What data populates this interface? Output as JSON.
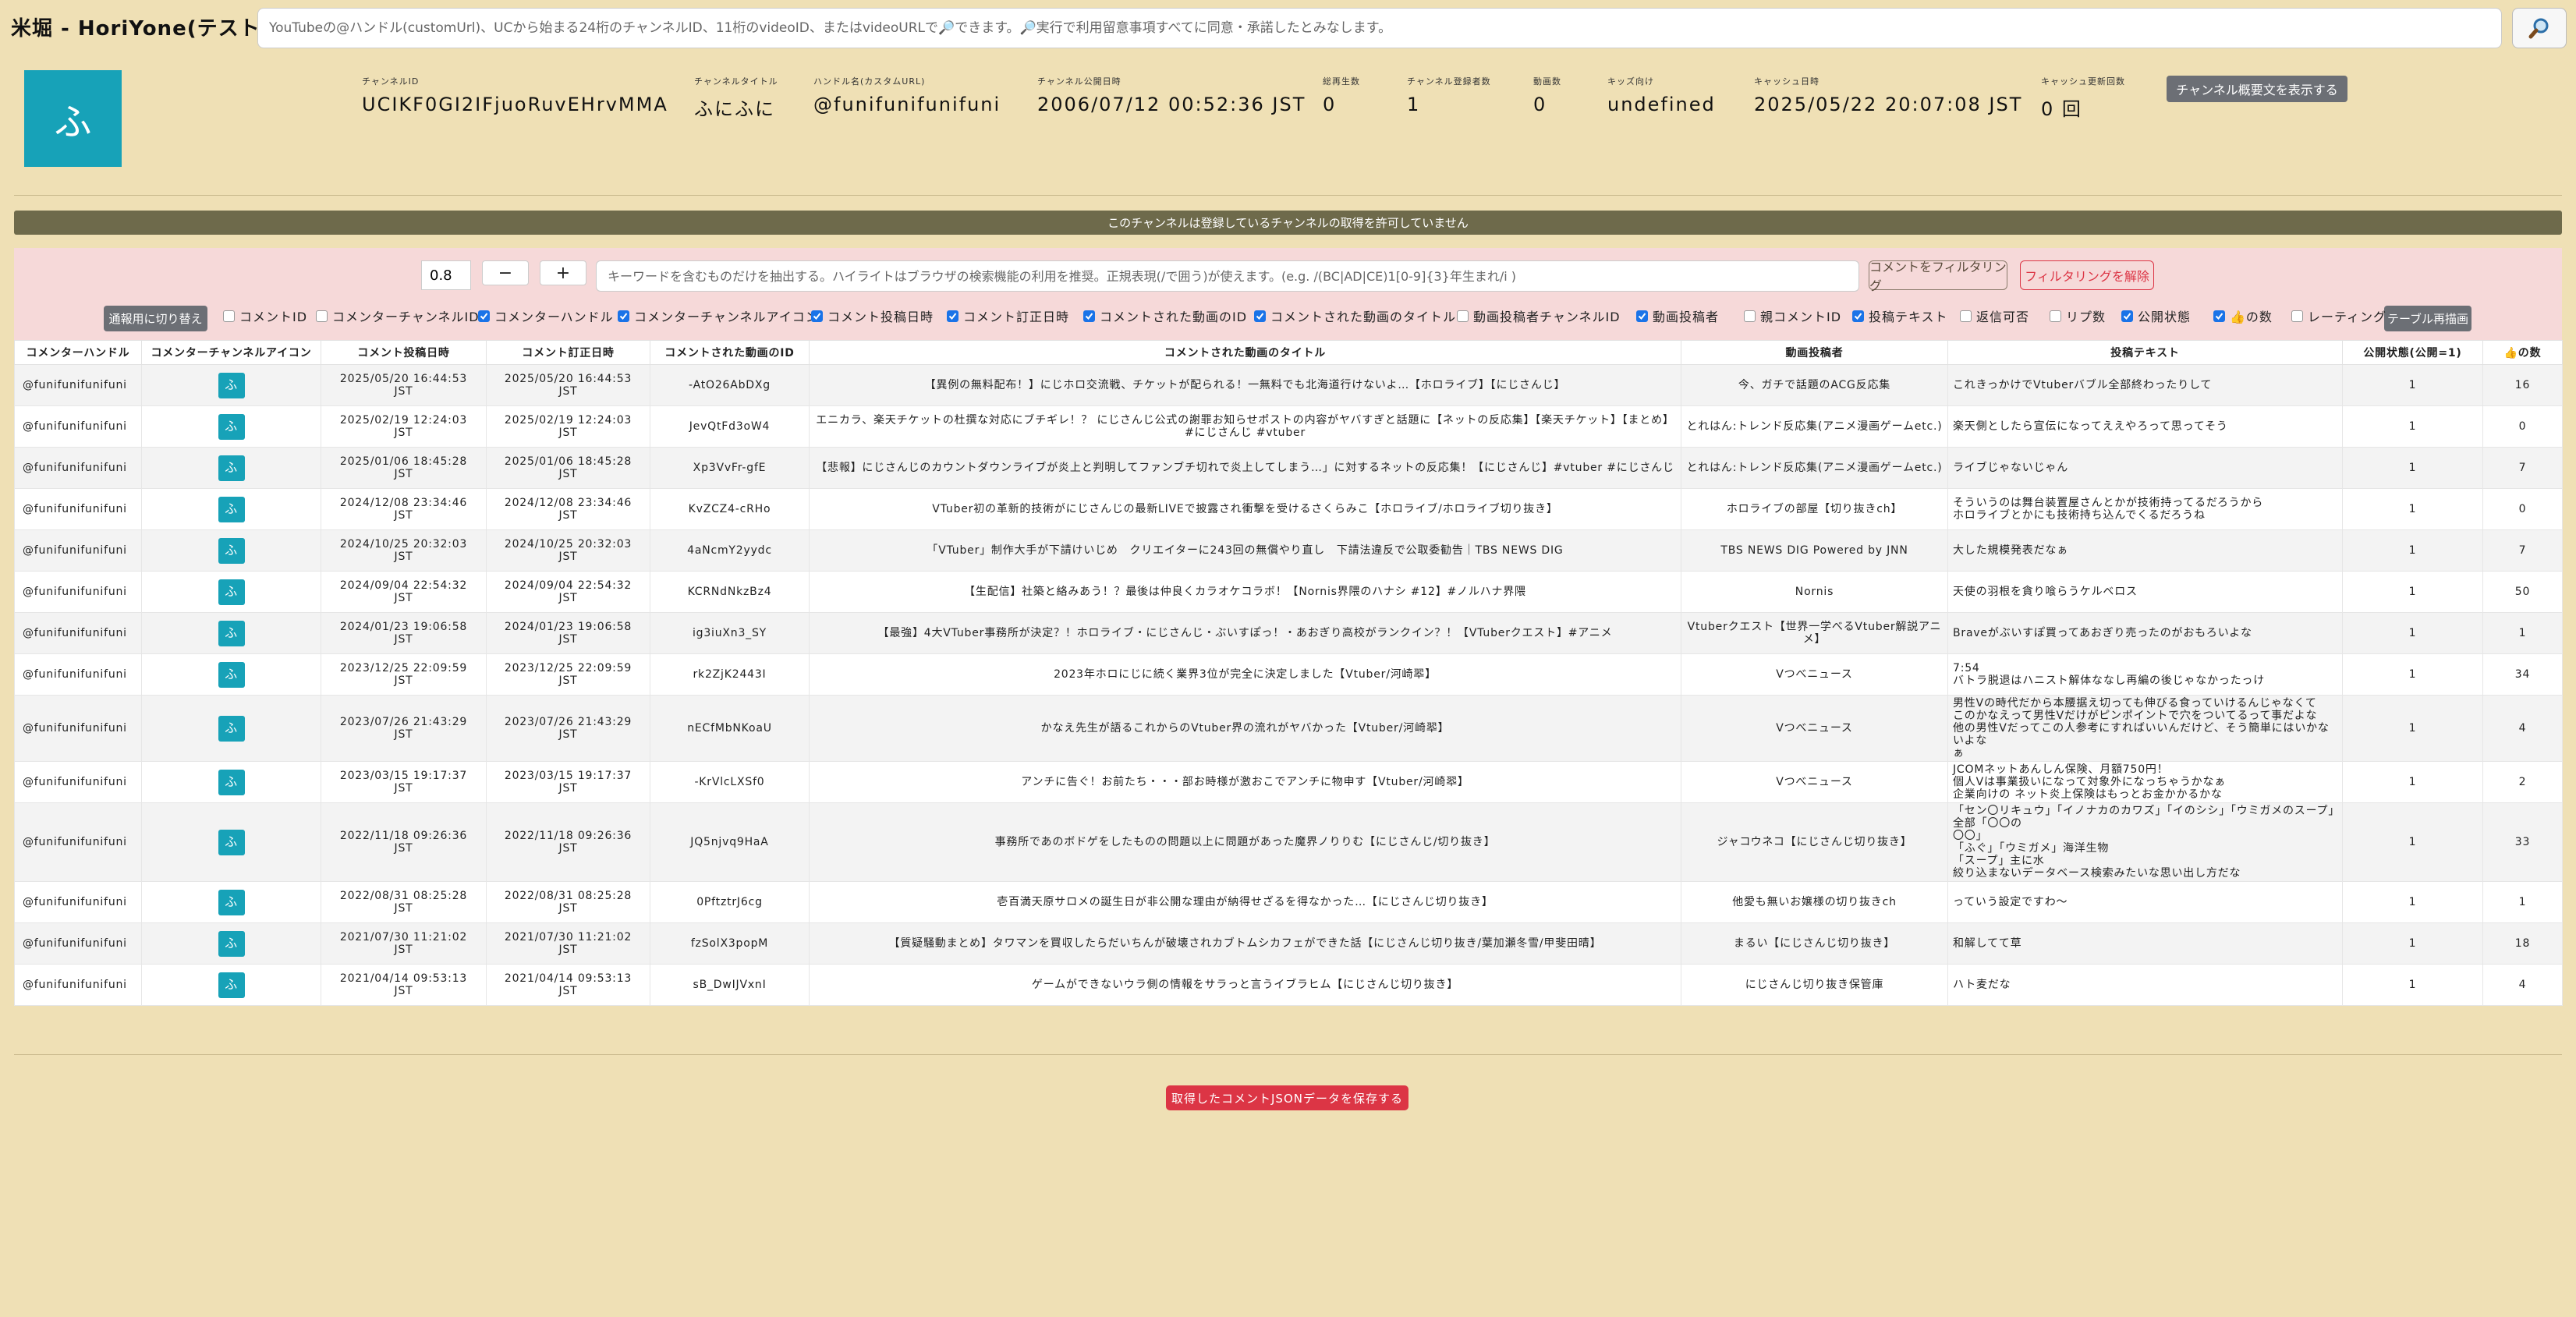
{
  "header": {
    "app_title": "米堀 - HoriYone(テスト中)",
    "search_placeholder": "YouTubeの@ハンドル(customUrl)、UCから始まる24桁のチャンネルID、11桁のvideoID、またはvideoURLで🔎できます。🔎実行で利用留意事項すべてに同意・承諾したとみなします。",
    "search_icon": "magnifier-icon"
  },
  "channel": {
    "avatar_char": "ふ",
    "fields": [
      {
        "label": "チャンネルID",
        "value": "UCIKF0GI2IFjuoRuvEHrvMMA"
      },
      {
        "label": "チャンネルタイトル",
        "value": "ふにふに"
      },
      {
        "label": "ハンドル名(カスタムURL)",
        "value": "@funifunifunifuni"
      },
      {
        "label": "チャンネル公開日時",
        "value": "2006/07/12 00:52:36 JST"
      },
      {
        "label": "総再生数",
        "value": "0"
      },
      {
        "label": "チャンネル登録者数",
        "value": "1"
      },
      {
        "label": "動画数",
        "value": "0"
      },
      {
        "label": "キッズ向け",
        "value": "undefined"
      },
      {
        "label": "キャッシュ日時",
        "value": "2025/05/22 20:07:08 JST"
      },
      {
        "label": "キャッシュ更新回数",
        "value": "0 回"
      }
    ],
    "desc_button": "チャンネル概要文を表示する"
  },
  "banner": "このチャンネルは登録しているチャンネルの取得を許可していません",
  "filter": {
    "zoom_value": "0.8",
    "minus_label": "−",
    "plus_label": "+",
    "keyword_placeholder": "キーワードを含むものだけを抽出する。ハイライトはブラウザの検索機能の利用を推奨。正規表現(/で囲う)が使えます。(e.g. /(BC|AD|CE)1[0-9]{3}年生まれ/i )",
    "filter_button": "コメントをフィルタリング",
    "clear_button": "フィルタリングを解除",
    "switch_button": "通報用に切り替え",
    "redraw_button": "テーブル再描画",
    "columns": [
      {
        "label": "コメントID",
        "checked": false
      },
      {
        "label": "コメンターチャンネルID",
        "checked": false
      },
      {
        "label": "コメンターハンドル",
        "checked": true
      },
      {
        "label": "コメンターチャンネルアイコン",
        "checked": true
      },
      {
        "label": "コメント投稿日時",
        "checked": true
      },
      {
        "label": "コメント訂正日時",
        "checked": true
      },
      {
        "label": "コメントされた動画のID",
        "checked": true
      },
      {
        "label": "コメントされた動画のタイトル",
        "checked": true
      },
      {
        "label": "動画投稿者チャンネルID",
        "checked": false
      },
      {
        "label": "動画投稿者",
        "checked": true
      },
      {
        "label": "親コメントID",
        "checked": false
      },
      {
        "label": "投稿テキスト",
        "checked": true
      },
      {
        "label": "返信可否",
        "checked": false
      },
      {
        "label": "リプ数",
        "checked": false
      },
      {
        "label": "公開状態",
        "checked": true
      },
      {
        "label": "👍の数",
        "checked": true
      },
      {
        "label": "レーティング",
        "checked": false
      }
    ]
  },
  "table": {
    "headers": [
      "コメンターハンドル",
      "コメンターチャンネルアイコン",
      "コメント投稿日時",
      "コメント訂正日時",
      "コメントされた動画のID",
      "コメントされた動画のタイトル",
      "動画投稿者",
      "投稿テキスト",
      "公開状態(公開=1)",
      "👍の数"
    ],
    "rows": [
      {
        "handle": "@funifunifunifuni",
        "icon": "ふ",
        "posted": "2025/05/20 16:44:53\nJST",
        "edited": "2025/05/20 16:44:53\nJST",
        "video_id": "-AtO26AbDXg",
        "title": "【異例の無料配布！】にじホロ交流戦、チケットが配られる！一無料でも北海道行けないよ…【ホロライブ】【にじさんじ】",
        "uploader": "今、ガチで話題のACG反応集",
        "text": "これきっかけでVtuberバブル全部終わったりして",
        "status": "1",
        "likes": "16"
      },
      {
        "handle": "@funifunifunifuni",
        "icon": "ふ",
        "posted": "2025/02/19 12:24:03\nJST",
        "edited": "2025/02/19 12:24:03\nJST",
        "video_id": "JevQtFd3oW4",
        "title": "エニカラ、楽天チケットの杜撰な対応にブチギレ！？ にじさんじ公式の謝罪お知らせポストの内容がヤバすぎと話題に【ネットの反応集】【楽天チケット】【まとめ】#にじさんじ #vtuber",
        "uploader": "とれはん:トレンド反応集(アニメ漫画ゲームetc.)",
        "text": "楽天側としたら宣伝になってええやろって思ってそう",
        "status": "1",
        "likes": "0"
      },
      {
        "handle": "@funifunifunifuni",
        "icon": "ふ",
        "posted": "2025/01/06 18:45:28\nJST",
        "edited": "2025/01/06 18:45:28\nJST",
        "video_id": "Xp3VvFr-gfE",
        "title": "【悲報】にじさんじのカウントダウンライブが炎上と判明してファンブチ切れで炎上してしまう…」に対するネットの反応集！【にじさんじ】#vtuber #にじさんじ",
        "uploader": "とれはん:トレンド反応集(アニメ漫画ゲームetc.)",
        "text": "ライブじゃないじゃん",
        "status": "1",
        "likes": "7"
      },
      {
        "handle": "@funifunifunifuni",
        "icon": "ふ",
        "posted": "2024/12/08 23:34:46\nJST",
        "edited": "2024/12/08 23:34:46\nJST",
        "video_id": "KvZCZ4-cRHo",
        "title": "VTuber初の革新的技術がにじさんじの最新LIVEで披露され衝撃を受けるさくらみこ【ホロライブ/ホロライブ切り抜き】",
        "uploader": "ホロライブの部屋【切り抜きch】",
        "text": "そういうのは舞台装置屋さんとかが技術持ってるだろうから\nホロライブとかにも技術持ち込んでくるだろうね",
        "status": "1",
        "likes": "0"
      },
      {
        "handle": "@funifunifunifuni",
        "icon": "ふ",
        "posted": "2024/10/25 20:32:03\nJST",
        "edited": "2024/10/25 20:32:03\nJST",
        "video_id": "4aNcmY2yydc",
        "title": "「VTuber」制作大手が下請けいじめ　クリエイターに243回の無償やり直し　下請法違反で公取委勧告｜TBS NEWS DIG",
        "uploader": "TBS NEWS DIG Powered by JNN",
        "text": "大した規模発表だなぁ",
        "status": "1",
        "likes": "7"
      },
      {
        "handle": "@funifunifunifuni",
        "icon": "ふ",
        "posted": "2024/09/04 22:54:32\nJST",
        "edited": "2024/09/04 22:54:32\nJST",
        "video_id": "KCRNdNkzBz4",
        "title": "【生配信】社築と絡みあう！？最後は仲良くカラオケコラボ！【Nornis界隈のハナシ #12】#ノルハナ界隈",
        "uploader": "Nornis",
        "text": "天使の羽根を貪り喰らうケルベロス",
        "status": "1",
        "likes": "50"
      },
      {
        "handle": "@funifunifunifuni",
        "icon": "ふ",
        "posted": "2024/01/23 19:06:58\nJST",
        "edited": "2024/01/23 19:06:58\nJST",
        "video_id": "ig3iuXn3_SY",
        "title": "【最強】4大VTuber事務所が決定？！ホロライブ・にじさんじ・ぶいすぽっ！・あおぎり高校がランクイン？！【VTuberクエスト】#アニメ",
        "uploader": "Vtuberクエスト【世界一学べるVtuber解説アニメ】",
        "text": "Braveがぶいすぽ買ってあおぎり売ったのがおもろいよな",
        "status": "1",
        "likes": "1"
      },
      {
        "handle": "@funifunifunifuni",
        "icon": "ふ",
        "posted": "2023/12/25 22:09:59\nJST",
        "edited": "2023/12/25 22:09:59\nJST",
        "video_id": "rk2ZjK2443I",
        "title": "2023年ホロにじに続く業界3位が完全に決定しました【Vtuber/河崎翆】",
        "uploader": "Vつべニュース",
        "text": "7:54\nバトラ脱退はハニスト解体ななし再編の後じゃなかったっけ",
        "status": "1",
        "likes": "34"
      },
      {
        "handle": "@funifunifunifuni",
        "icon": "ふ",
        "posted": "2023/07/26 21:43:29\nJST",
        "edited": "2023/07/26 21:43:29\nJST",
        "video_id": "nECfMbNKoaU",
        "title": "かなえ先生が語るこれからのVtuber界の流れがヤバかった【Vtuber/河崎翆】",
        "uploader": "Vつべニュース",
        "text": "男性Vの時代だから本腰据え切っても伸びる食っていけるんじゃなくて\nこのかなえって男性Vだけがピンポイントで穴をついてるって事だよな\n他の男性Vだってこの人参考にすればいいんだけど、そう簡単にはいかないよな\nぁ",
        "status": "1",
        "likes": "4"
      },
      {
        "handle": "@funifunifunifuni",
        "icon": "ふ",
        "posted": "2023/03/15 19:17:37\nJST",
        "edited": "2023/03/15 19:17:37\nJST",
        "video_id": "-KrVlcLXSf0",
        "title": "アンチに告ぐ！お前たち・・・部お時様が激おこでアンチに物申す【Vtuber/河崎翆】",
        "uploader": "Vつべニュース",
        "text": "JCOMネットあんしん保険、月額750円！\n個人Vは事業扱いになって対象外になっちゃうかなぁ\n企業向けの ネット炎上保険はもっとお金かかるかな",
        "status": "1",
        "likes": "2"
      },
      {
        "handle": "@funifunifunifuni",
        "icon": "ふ",
        "posted": "2022/11/18 09:26:36\nJST",
        "edited": "2022/11/18 09:26:36\nJST",
        "video_id": "JQ5njvq9HaA",
        "title": "事務所であのボドゲをしたものの問題以上に問題があった魔界ノりりむ【にじさんじ/切り抜き】",
        "uploader": "ジャコウネコ【にじさんじ切り抜き】",
        "text": "「セン〇リキュウ」「イノナカのカワズ」「イのシシ」「ウミガメのスープ」全部「〇〇の\n〇〇」\n「ふぐ」「ウミガメ」海洋生物\n「スープ」主に水\n絞り込まないデータベース検索みたいな思い出し方だな",
        "status": "1",
        "likes": "33"
      },
      {
        "handle": "@funifunifunifuni",
        "icon": "ふ",
        "posted": "2022/08/31 08:25:28\nJST",
        "edited": "2022/08/31 08:25:28\nJST",
        "video_id": "0PftztrJ6cg",
        "title": "壱百満天原サロメの誕生日が非公開な理由が納得せざるを得なかった…【にじさんじ切り抜き】",
        "uploader": "他愛も無いお嬢様の切り抜きch",
        "text": "っていう設定ですわ〜",
        "status": "1",
        "likes": "1"
      },
      {
        "handle": "@funifunifunifuni",
        "icon": "ふ",
        "posted": "2021/07/30 11:21:02\nJST",
        "edited": "2021/07/30 11:21:02\nJST",
        "video_id": "fzSolX3popM",
        "title": "【質疑騒動まとめ】タワマンを買収したらだいちんが破壊されカブトムシカフェができた話【にじさんじ切り抜き/葉加瀬冬雪/甲斐田晴】",
        "uploader": "まるい【にじさんじ切り抜き】",
        "text": "和解してて草",
        "status": "1",
        "likes": "18"
      },
      {
        "handle": "@funifunifunifuni",
        "icon": "ふ",
        "posted": "2021/04/14 09:53:13\nJST",
        "edited": "2021/04/14 09:53:13\nJST",
        "video_id": "sB_DwIJVxnI",
        "title": "ゲームができないウラ側の情報をサラっと言うイブラヒム【にじさんじ切り抜き】",
        "uploader": "にじさんじ切り抜き保管庫",
        "text": "ハト麦だな",
        "status": "1",
        "likes": "4"
      }
    ]
  },
  "save_button": "取得したコメントJSONデータを保存する"
}
